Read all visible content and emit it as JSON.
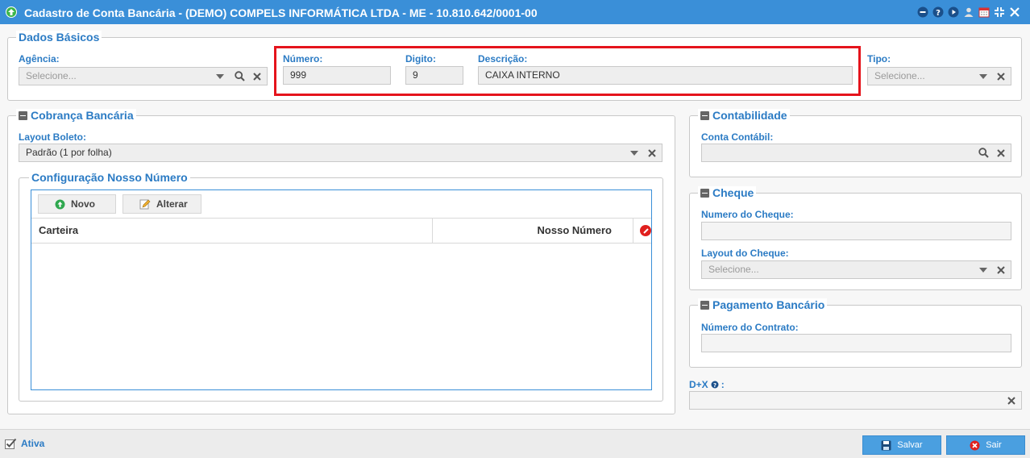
{
  "window": {
    "title": "Cadastro de Conta Bancária - (DEMO) COMPELS INFORMÁTICA LTDA - ME - 10.810.642/0001-00"
  },
  "dados_basicos": {
    "legend": "Dados Básicos",
    "agencia": {
      "label": "Agência:",
      "placeholder": "Selecione..."
    },
    "numero": {
      "label": "Número:",
      "value": "999"
    },
    "digito": {
      "label": "Digito:",
      "value": "9"
    },
    "descricao": {
      "label": "Descrição:",
      "value": "CAIXA INTERNO"
    },
    "tipo": {
      "label": "Tipo:",
      "placeholder": "Selecione..."
    }
  },
  "cobranca": {
    "legend": "Cobrança Bancária",
    "layout_boleto": {
      "label": "Layout Boleto:",
      "value": "Padrão (1 por folha)"
    },
    "config": {
      "legend": "Configuração Nosso Número",
      "buttons": {
        "novo": "Novo",
        "alterar": "Alterar"
      },
      "columns": {
        "carteira": "Carteira",
        "nosso_numero": "Nosso Número"
      },
      "rows": []
    }
  },
  "contabilidade": {
    "legend": "Contabilidade",
    "conta_contabil": {
      "label": "Conta Contábil:",
      "value": ""
    }
  },
  "cheque": {
    "legend": "Cheque",
    "numero": {
      "label": "Numero do Cheque:",
      "value": ""
    },
    "layout": {
      "label": "Layout do Cheque:",
      "placeholder": "Selecione..."
    }
  },
  "pagamento": {
    "legend": "Pagamento Bancário",
    "contrato": {
      "label": "Número do Contrato:",
      "value": ""
    }
  },
  "dx": {
    "label": "D+X",
    "value": ""
  },
  "footer": {
    "ativa_label": "Ativa",
    "salvar": "Salvar",
    "sair": "Sair"
  },
  "colors": {
    "titlebar": "#3a8fd8",
    "label_blue": "#2b7bc4",
    "highlight_red": "#e5141c",
    "button_blue": "#4a9fe0"
  }
}
